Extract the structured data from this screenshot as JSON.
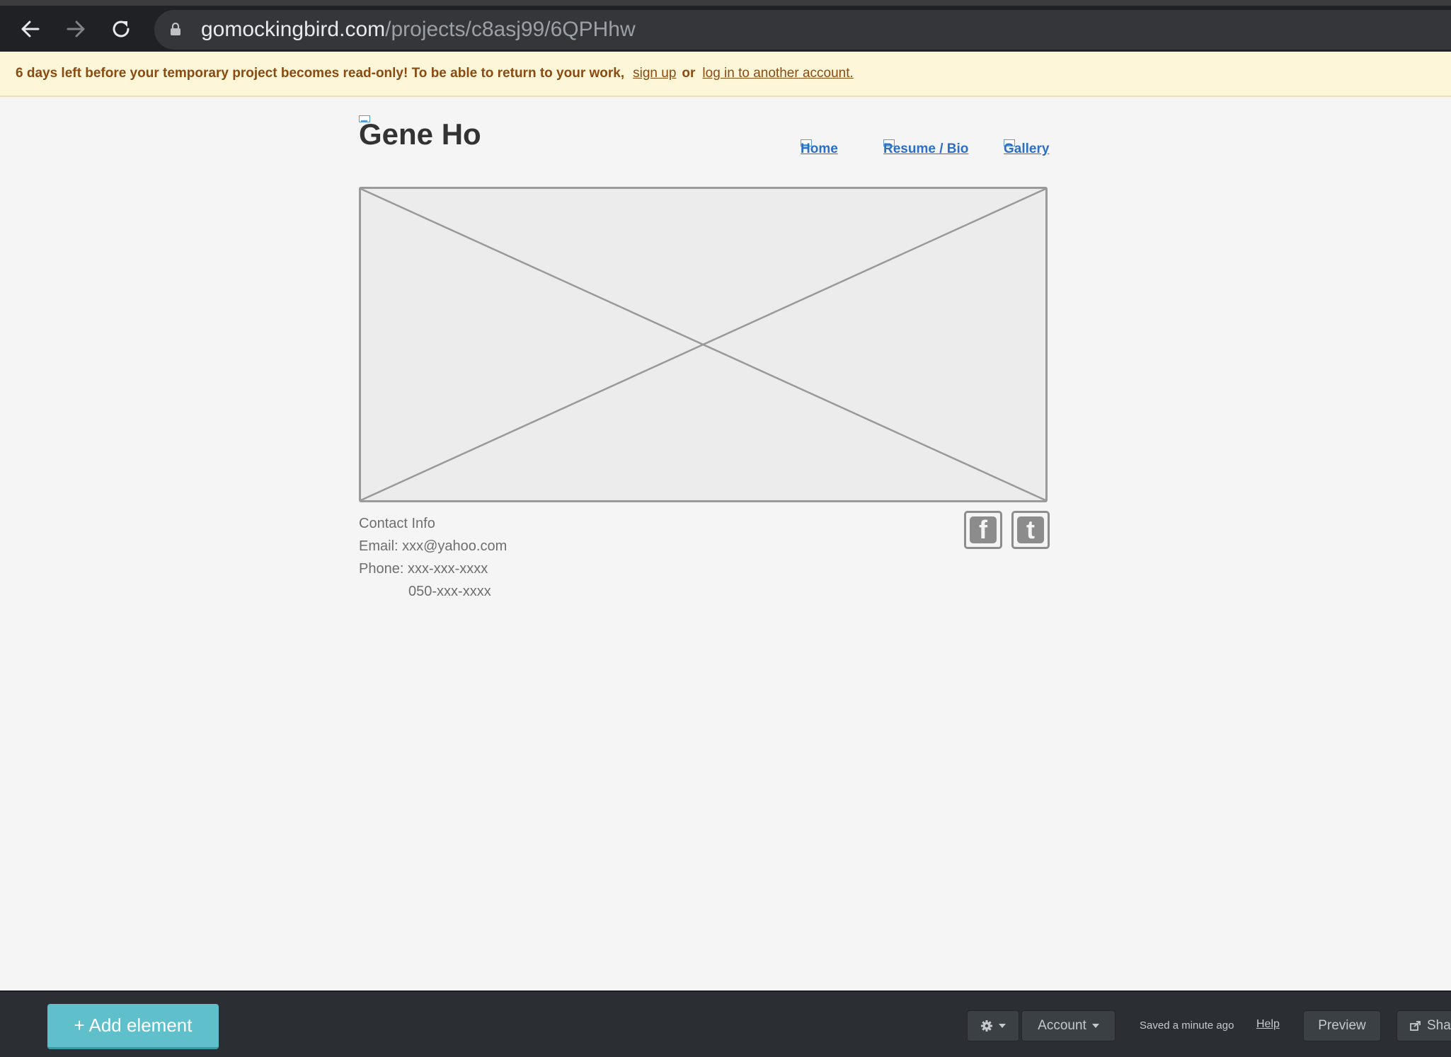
{
  "browser": {
    "url_domain": "gomockingbird.com",
    "url_path": "/projects/c8asj99/6QPHhw",
    "back_icon": "arrow-left-icon",
    "forward_icon": "arrow-right-icon",
    "reload_icon": "reload-icon",
    "lock_icon": "lock-icon"
  },
  "notice": {
    "message": "6 days left before your temporary project becomes read-only! To be able to return to your work,",
    "sign_up": "sign up",
    "or": "or",
    "log_in": "log in to another account."
  },
  "mockup": {
    "title": "Gene Ho",
    "nav": [
      "Home",
      "Resume / Bio",
      "Gallery"
    ],
    "contact": {
      "heading": "Contact Info",
      "email": "Email: xxx@yahoo.com",
      "phone": "Phone: xxx-xxx-xxxx",
      "phone2": "050-xxx-xxxx"
    },
    "social": {
      "facebook_glyph": "f",
      "twitter_glyph": "t"
    }
  },
  "toolbar": {
    "add_element": "+ Add element",
    "account": "Account",
    "saved_status": "Saved a minute ago",
    "help": "Help",
    "preview": "Preview",
    "share": "Sha",
    "gear_icon": "gear-icon",
    "share_icon": "share-icon"
  }
}
